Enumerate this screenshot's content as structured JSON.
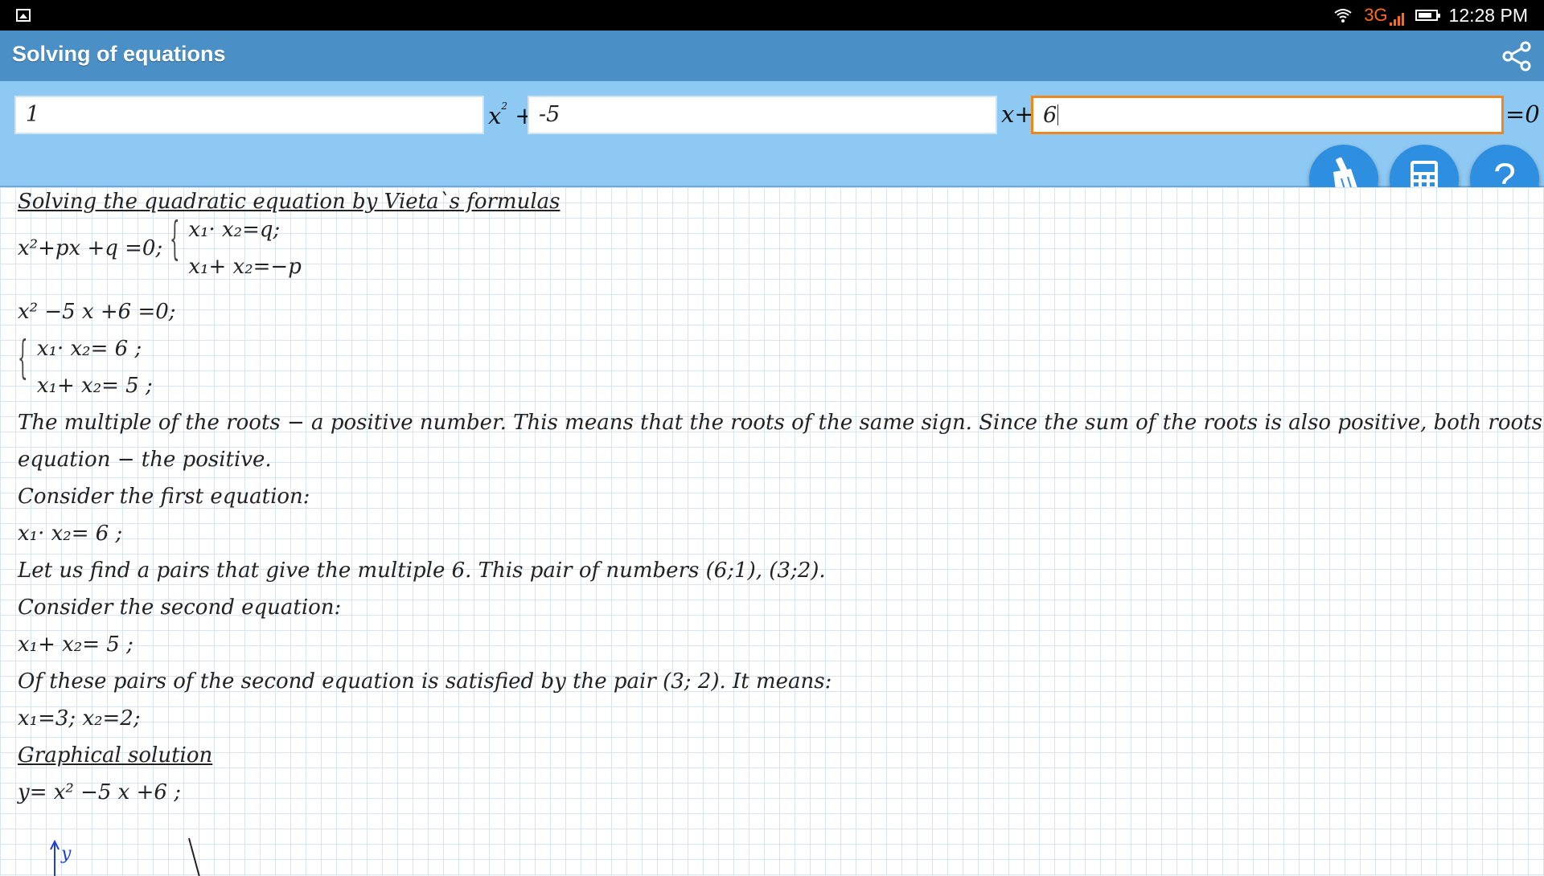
{
  "status_bar": {
    "network": "3G",
    "time": "12:28 PM"
  },
  "app": {
    "title": "Solving of equations"
  },
  "inputs": {
    "a": "1",
    "b": "-5",
    "c": "6",
    "sym_x2": "x",
    "sym_x2_exp": "2",
    "sym_plus1": "+",
    "sym_x": "x+",
    "sym_eq": "=0"
  },
  "solution": {
    "heading": "Solving the quadratic equation by Vieta`s formulas",
    "general_lhs": "x²+px +q =0;",
    "general_sys1": "x₁· x₂=q;",
    "general_sys2": "x₁+ x₂=−p",
    "equation": "x² −5 x +6 =0;",
    "sys1": "x₁· x₂= 6 ;",
    "sys2": "x₁+ x₂= 5 ;",
    "para1a": "The multiple of the roots − a positive number. This means that the roots of the same sign. Since the sum of the roots is also positive, both roots of the",
    "para1b": "equation − the positive.",
    "consider_first": "Consider the first equation:",
    "first_eq": "x₁· x₂= 6 ;",
    "pairs": "Let us find a pairs that give the multiple 6. This pair of numbers (6;1), (3;2).",
    "consider_second": "Consider the second equation:",
    "second_eq": "x₁+ x₂= 5 ;",
    "satisfied": "Of these pairs of the second equation is satisfied by the pair (3; 2). It means:",
    "roots": "x₁=3; x₂=2;",
    "graph_heading": "Graphical solution",
    "graph_eq": "y= x² −5 x +6 ;",
    "graph_axis_label": "y"
  },
  "colors": {
    "accent": "#f0861e",
    "titlebar": "#4a90c7",
    "panel": "#8ec9f3",
    "fab": "#2e8fe0"
  },
  "icons": [
    "gallery-icon",
    "wifi-icon",
    "signal-icon",
    "battery-icon",
    "share-icon",
    "broom-icon",
    "calculator-icon",
    "help-icon"
  ]
}
